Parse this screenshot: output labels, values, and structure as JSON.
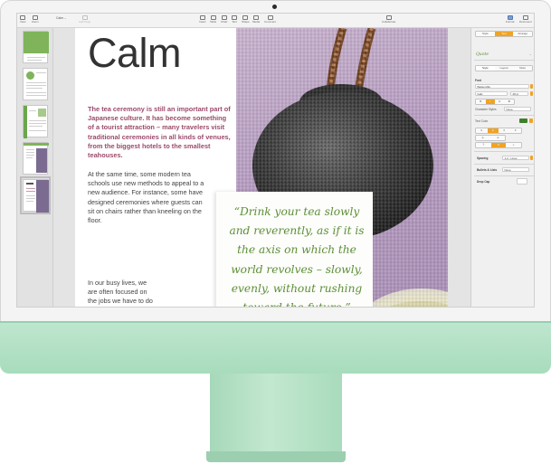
{
  "toolbar": {
    "view": "View",
    "zoom": "Zoom",
    "add_page": "Add Page",
    "insert": "Insert",
    "table": "Table",
    "chart": "Chart",
    "text": "Text",
    "shape": "Shape",
    "media": "Media",
    "comment": "Comment",
    "collaborate": "Collaborate",
    "format": "Format",
    "document": "Document",
    "doc_title": "Calm"
  },
  "document": {
    "title": "Calm",
    "lead": "The tea ceremony is still an important part of Japanese culture. It has become something of a tourist attraction – many travelers visit traditional ceremonies in all kinds of venues, from the biggest hotels to the smallest teahouses.",
    "body1": "At the same time, some modern tea schools use new methods to appeal to a new audience. For instance, some have designed ceremonies where guests can sit on chairs rather than kneeling on the floor.",
    "body2": "In our busy lives, we are often focused on the jobs we have to do and the deadlines",
    "quote": "“Drink your tea slowly and reverently, as if it is the axis on which the world revolves – slowly, evenly, without rushing toward the future.”"
  },
  "inspector": {
    "tabs": [
      "Style",
      "Text",
      "Arrange"
    ],
    "active_tab": "Text",
    "paragraph_style": "Quote",
    "sub_tabs": [
      "Style",
      "Layout",
      "More"
    ],
    "font_section": "Font",
    "font_name": "Baskerville",
    "font_style": "Italic",
    "font_size": "28 pt",
    "format_buttons": [
      "B",
      "I",
      "U",
      "⚙"
    ],
    "character_styles_label": "Character Styles",
    "character_styles_value": "None",
    "text_color_label": "Text Color",
    "text_color": "#3f7f2c",
    "spacing_label": "Spacing",
    "spacing_value": "1.2 - Lines",
    "bullets_label": "Bullets & Lists",
    "bullets_value": "None",
    "drop_cap_label": "Drop Cap"
  }
}
